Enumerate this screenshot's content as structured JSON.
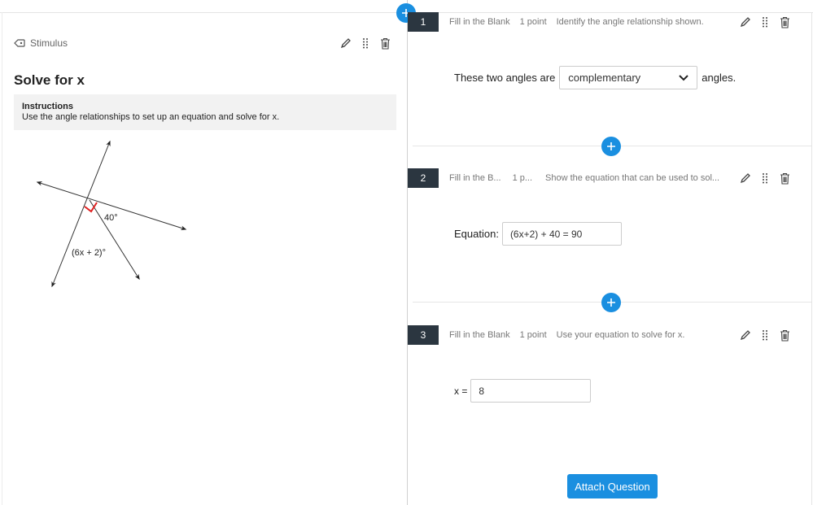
{
  "stimulus": {
    "header_label": "Stimulus",
    "title": "Solve for x",
    "instructions_title": "Instructions",
    "instructions_text": "Use the angle relationships to set up an equation and solve for x.",
    "diagram": {
      "angle_label_1": "40°",
      "angle_label_2": "(6x + 2)°"
    }
  },
  "questions": [
    {
      "number": "1",
      "type": "Fill in the Blank",
      "points": "1 point",
      "description": "Identify the angle relationship shown.",
      "prefix": "These two angles are",
      "select_value": "complementary",
      "suffix": "angles."
    },
    {
      "number": "2",
      "type": "Fill in the B...",
      "points": "1 p...",
      "description": "Show the equation that can be used to sol...",
      "prefix": "Equation:",
      "input_value": "(6x+2) + 40 = 90"
    },
    {
      "number": "3",
      "type": "Fill in the Blank",
      "points": "1 point",
      "description": "Use your equation to solve for x.",
      "prefix": "x =",
      "input_value": "8"
    }
  ],
  "attach_button_label": "Attach Question",
  "colors": {
    "accent": "#1a8fe0",
    "question_number_bg": "#2b3640",
    "right_angle_mark": "#e02020"
  },
  "icons": [
    "stimulus-icon",
    "pencil-icon",
    "drag-handle-icon",
    "trash-icon",
    "plus-icon",
    "chevron-down-icon"
  ]
}
